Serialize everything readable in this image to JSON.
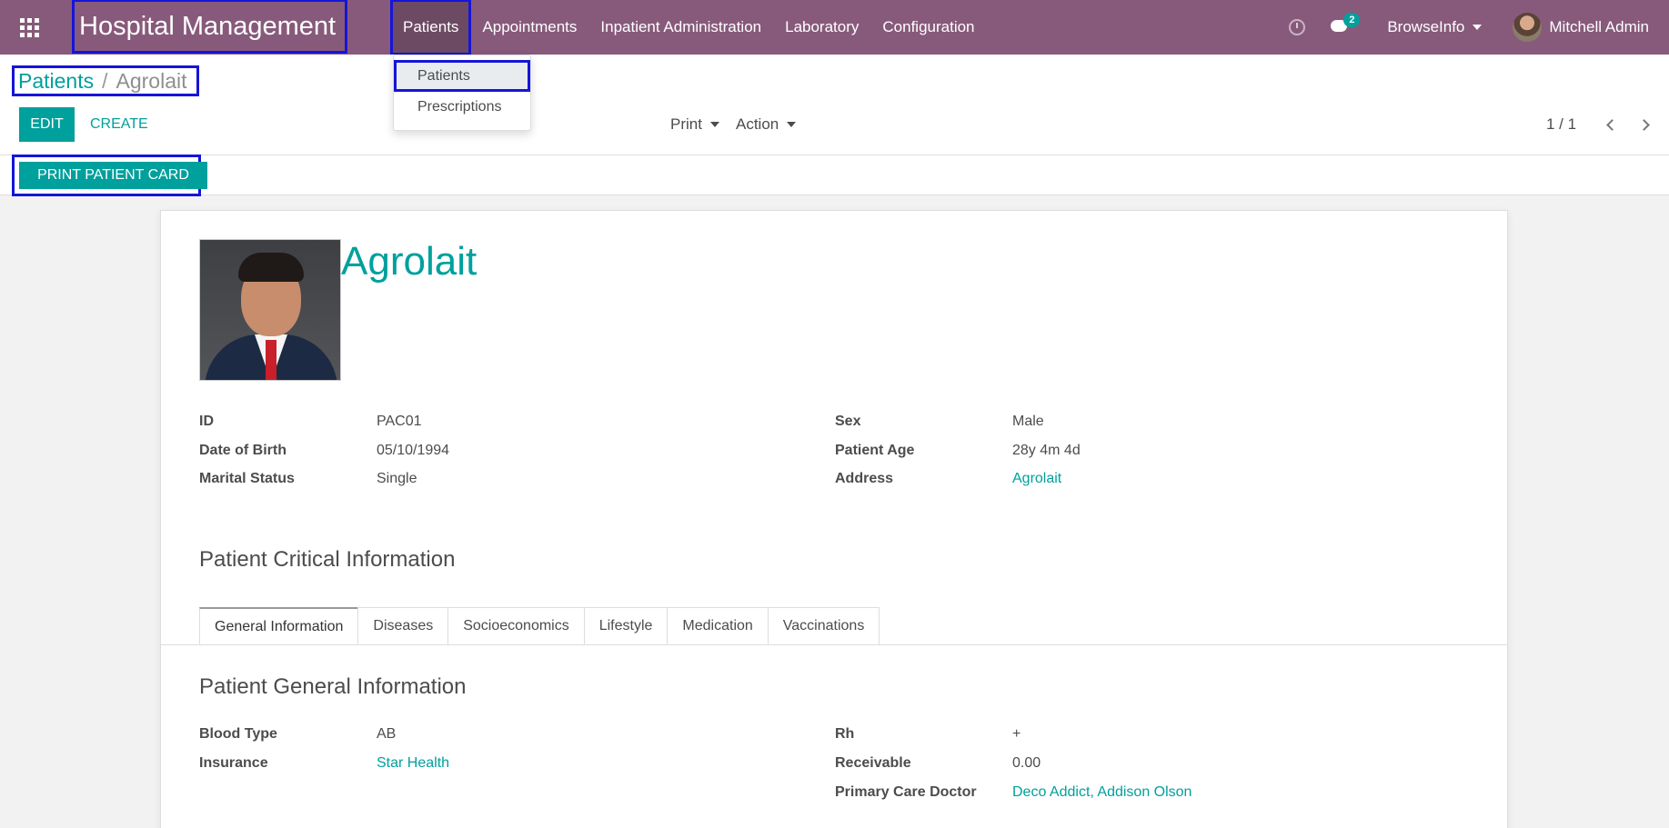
{
  "colors": {
    "navbar": "#875a7b",
    "accent": "#00a09d",
    "highlight": "#1515d8"
  },
  "navbar": {
    "apps_icon": "apps-grid-icon",
    "brand": "Hospital Management",
    "menu": [
      {
        "label": "Patients"
      },
      {
        "label": "Appointments"
      },
      {
        "label": "Inpatient Administration"
      },
      {
        "label": "Laboratory"
      },
      {
        "label": "Configuration"
      }
    ],
    "messages_count": "2",
    "company": "BrowseInfo",
    "user": "Mitchell Admin"
  },
  "dropdown": {
    "items": [
      {
        "label": "Patients"
      },
      {
        "label": "Prescriptions"
      }
    ]
  },
  "breadcrumb": {
    "parent": "Patients",
    "separator": "/",
    "current": "Agrolait"
  },
  "toolbar": {
    "edit": "EDIT",
    "create": "CREATE",
    "print": "Print",
    "action": "Action",
    "pager": "1 / 1"
  },
  "statusbar": {
    "print_card": "PRINT PATIENT CARD"
  },
  "patient": {
    "name": "Agrolait",
    "left_fields": [
      {
        "label": "ID",
        "value": "PAC01"
      },
      {
        "label": "Date of Birth",
        "value": "05/10/1994"
      },
      {
        "label": "Marital Status",
        "value": "Single"
      }
    ],
    "right_fields": [
      {
        "label": "Sex",
        "value": "Male"
      },
      {
        "label": "Patient Age",
        "value": "28y 4m 4d"
      },
      {
        "label": "Address",
        "value": "Agrolait"
      }
    ]
  },
  "critical": {
    "title": "Patient Critical Information",
    "tabs": [
      {
        "label": "General Information"
      },
      {
        "label": "Diseases"
      },
      {
        "label": "Socioeconomics"
      },
      {
        "label": "Lifestyle"
      },
      {
        "label": "Medication"
      },
      {
        "label": "Vaccinations"
      }
    ]
  },
  "general": {
    "title": "Patient General Information",
    "left_fields": [
      {
        "label": "Blood Type",
        "value": "AB"
      },
      {
        "label": "Insurance",
        "value": "Star Health"
      }
    ],
    "right_fields": [
      {
        "label": "Rh",
        "value": "+"
      },
      {
        "label": "Receivable",
        "value": "0.00"
      },
      {
        "label": "Primary Care Doctor",
        "value": "Deco Addict, Addison Olson"
      }
    ]
  }
}
